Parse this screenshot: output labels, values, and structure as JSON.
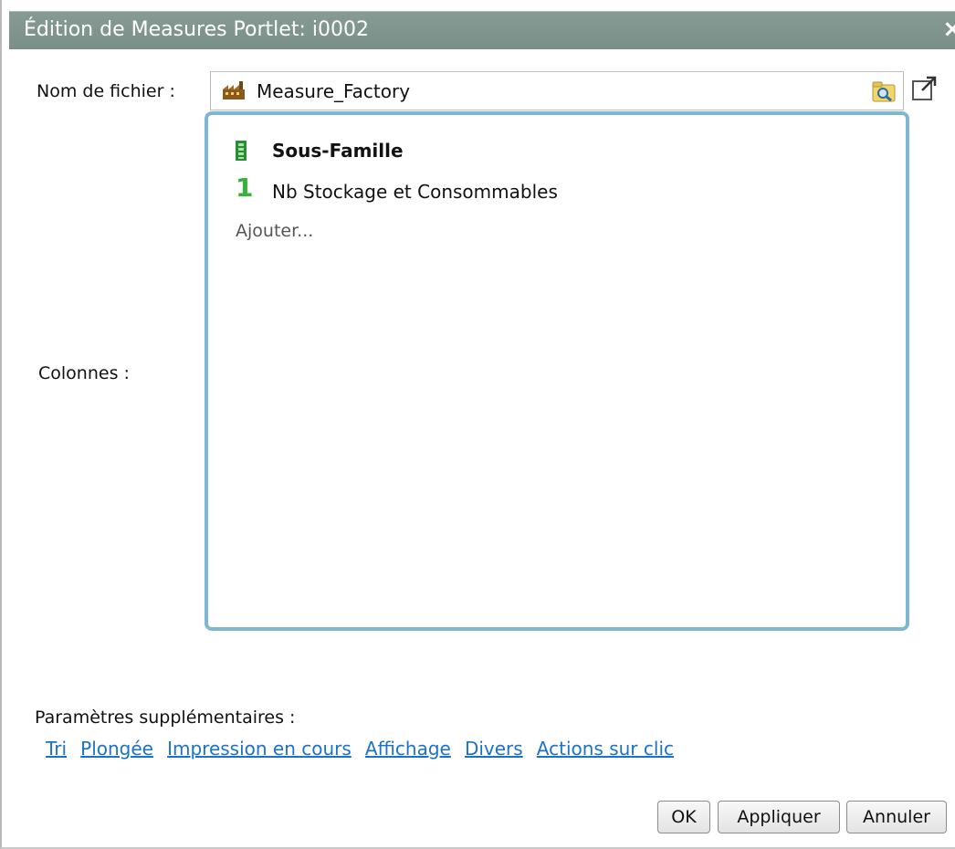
{
  "dialog": {
    "title": "Édition de Measures Portlet: i0002",
    "close_symbol": "×"
  },
  "form": {
    "filename_label": "Nom de fichier :",
    "filename_value": "Measure_Factory",
    "columns_label": "Colonnes :",
    "extra_params_label": "Paramètres supplémentaires :"
  },
  "columns": {
    "items": [
      {
        "label": "Sous-Famille",
        "kind": "dimension",
        "icon": "dimension-icon"
      },
      {
        "label": "Nb Stockage et Consommables",
        "kind": "measure",
        "icon": "measure-icon",
        "icon_text": "1"
      }
    ],
    "add_label": "Ajouter..."
  },
  "extra_params": {
    "links": [
      "Tri",
      "Plongée",
      "Impression en cours",
      "Affichage",
      "Divers",
      "Actions sur clic"
    ]
  },
  "buttons": {
    "ok": "OK",
    "apply": "Appliquer",
    "cancel": "Annuler"
  },
  "colors": {
    "titlebar": "#7f938d",
    "columns_border": "#7fb7d3",
    "link": "#1a73c8",
    "measure_icon": "#38b13a",
    "dimension_icon": "#2e8b34"
  },
  "icons": [
    "close-icon",
    "factory-icon",
    "browse-folder-icon",
    "open-external-icon",
    "dimension-icon",
    "measure-icon"
  ]
}
